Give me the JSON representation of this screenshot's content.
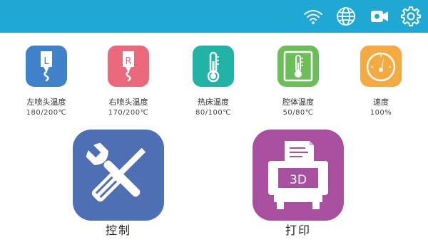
{
  "colors": {
    "topbar": "#1fa8d4",
    "left_nozzle": "#3f82c9",
    "right_nozzle": "#e9687a",
    "bed": "#22b3a7",
    "chamber": "#6cbf58",
    "speed": "#f4aa41",
    "control": "#4f6fb5",
    "print": "#a94f9f"
  },
  "topbar": {
    "icons": [
      "wifi-icon",
      "globe-icon",
      "camera-icon",
      "gear-icon"
    ]
  },
  "status": {
    "left_nozzle": {
      "label": "左喷头温度",
      "value": "180/200℃",
      "glyph": "L"
    },
    "right_nozzle": {
      "label": "右喷头温度",
      "value": "170/200℃",
      "glyph": "R"
    },
    "bed": {
      "label": "热床温度",
      "value": "80/100℃"
    },
    "chamber": {
      "label": "腔体温度",
      "value": "50/80℃"
    },
    "speed": {
      "label": "速度",
      "value": "100%"
    }
  },
  "main": {
    "control_label": "控制",
    "print_label": "打印",
    "print_glyph": "3D"
  }
}
